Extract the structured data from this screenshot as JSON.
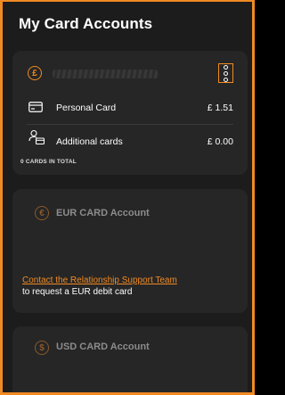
{
  "page": {
    "title": "My Card Accounts"
  },
  "gbp_account": {
    "currency_symbol": "£",
    "rows": [
      {
        "label": "Personal Card",
        "amount": "£ 1.51",
        "icon": "card-icon"
      },
      {
        "label": "Additional cards",
        "amount": "£ 0.00",
        "icon": "person-card-icon"
      }
    ],
    "cards_total": "0 CARDS IN TOTAL"
  },
  "eur_account": {
    "currency_symbol": "€",
    "title": "EUR CARD Account",
    "link_text": "Contact the Relationship Support Team",
    "note": "to request a EUR debit card"
  },
  "usd_account": {
    "currency_symbol": "$",
    "title": "USD CARD Account"
  },
  "colors": {
    "accent": "#f08a24",
    "background": "#1c1c1c",
    "card": "#262626"
  }
}
